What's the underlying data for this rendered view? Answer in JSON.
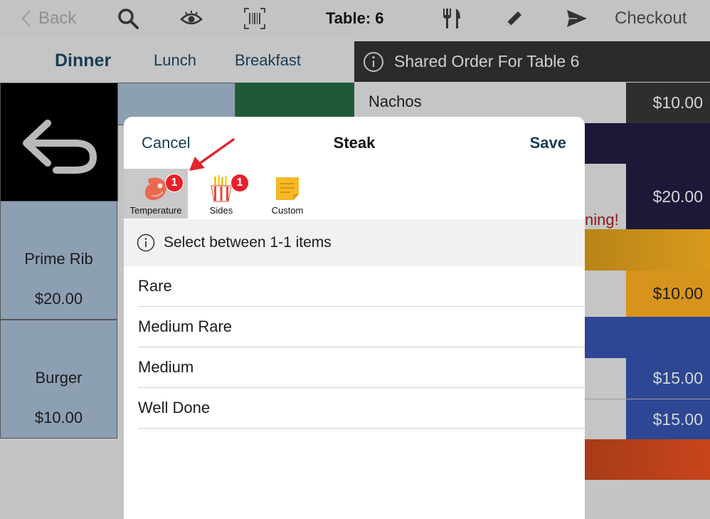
{
  "toolbar": {
    "back_label": "Back",
    "table_label": "Table: 6",
    "checkout_label": "Checkout",
    "icons": [
      "search-icon",
      "eye-icon",
      "barcode-icon",
      "fork-knife-icon",
      "pencil-icon",
      "send-icon"
    ]
  },
  "menu_tabs": [
    {
      "label": "Dinner",
      "active": true
    },
    {
      "label": "Lunch",
      "active": false
    },
    {
      "label": "Breakfast",
      "active": false
    }
  ],
  "order_panel": {
    "header": "Shared Order For Table 6",
    "items": [
      {
        "name": "Nachos",
        "price": "$10.00"
      },
      {
        "name": "",
        "price": "$20.00"
      },
      {
        "name": "",
        "price": "$10.00"
      },
      {
        "name": "",
        "price": "$15.00"
      },
      {
        "name": "",
        "price": "$15.00"
      }
    ],
    "partial_text": "ning!"
  },
  "menu_items": [
    {
      "name": "Prime Rib",
      "price": "$20.00"
    },
    {
      "name": "Burger",
      "price": "$10.00"
    }
  ],
  "modal": {
    "cancel_label": "Cancel",
    "title": "Steak",
    "save_label": "Save",
    "modifier_tabs": [
      {
        "label": "Temperature",
        "badge": "1",
        "selected": true,
        "icon": "steak-icon"
      },
      {
        "label": "Sides",
        "badge": "1",
        "selected": false,
        "icon": "fries-icon"
      },
      {
        "label": "Custom",
        "badge": "",
        "selected": false,
        "icon": "sticky-note-icon"
      }
    ],
    "instruction": "Select between 1-1 items",
    "options": [
      "Rare",
      "Medium Rare",
      "Medium",
      "Well Done"
    ]
  },
  "colors": {
    "accent": "#173d55",
    "badge": "#e8202a",
    "annotation_arrow": "#e0252b"
  }
}
